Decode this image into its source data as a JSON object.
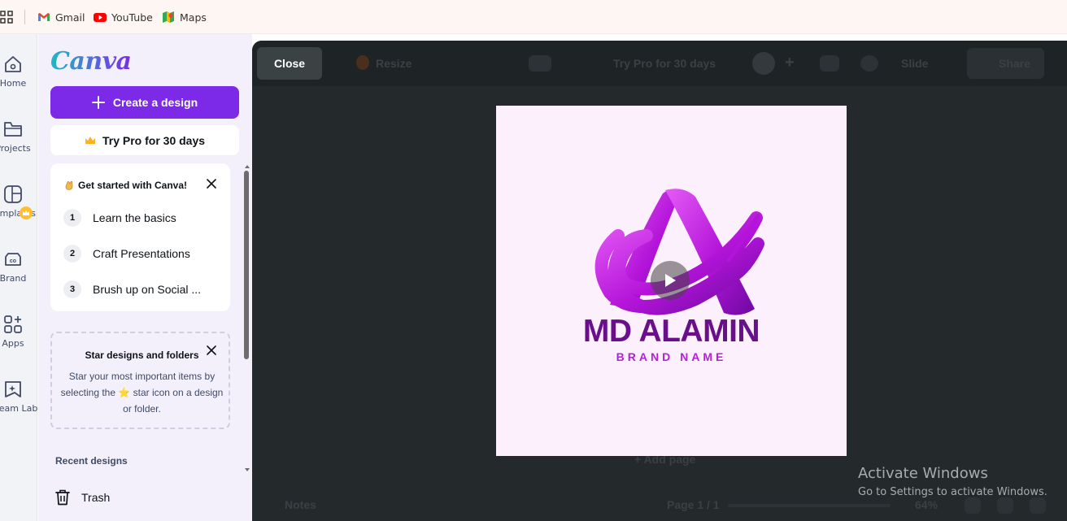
{
  "bookmarks": {
    "apps_icon": "apps-grid-icon",
    "items": [
      {
        "label": "Gmail",
        "icon": "gmail-icon"
      },
      {
        "label": "YouTube",
        "icon": "youtube-icon"
      },
      {
        "label": "Maps",
        "icon": "maps-icon"
      }
    ]
  },
  "rail": {
    "items": [
      {
        "label": "Home",
        "icon": "home-icon"
      },
      {
        "label": "Projects",
        "icon": "folder-icon"
      },
      {
        "label": "Templates",
        "icon": "templates-icon"
      },
      {
        "label": "Brand",
        "icon": "brand-icon"
      },
      {
        "label": "Apps",
        "icon": "apps-icon"
      },
      {
        "label": "Dream Lab",
        "icon": "dream-lab-icon"
      }
    ]
  },
  "sidebar": {
    "logo": "Canva",
    "create_label": "Create a design",
    "pro_label": "Try Pro for 30 days",
    "get_started": {
      "title": "Get started with Canva!",
      "steps": [
        {
          "num": "1",
          "label": "Learn the basics"
        },
        {
          "num": "2",
          "label": "Craft Presentations"
        },
        {
          "num": "3",
          "label": "Brush up on Social ..."
        }
      ]
    },
    "star_tip": {
      "title": "Star designs and folders",
      "body": "Star your most important items by selecting the ⭐ star icon on a design or folder."
    },
    "recent_label": "Recent designs",
    "trash_label": "Trash"
  },
  "preview": {
    "close_label": "Close",
    "ghost": {
      "resize": "Resize",
      "try_pro": "Try Pro for 30 days",
      "share": "Share",
      "slide": "Slide",
      "add_page": "+ Add page",
      "notes": "Notes",
      "page": "Page 1 / 1",
      "zoom": "64%"
    },
    "design": {
      "title": "MD ALAMIN",
      "subtitle": "BRAND NAME"
    }
  },
  "os": {
    "activate_title": "Activate Windows",
    "activate_sub": "Go to Settings to activate Windows."
  }
}
